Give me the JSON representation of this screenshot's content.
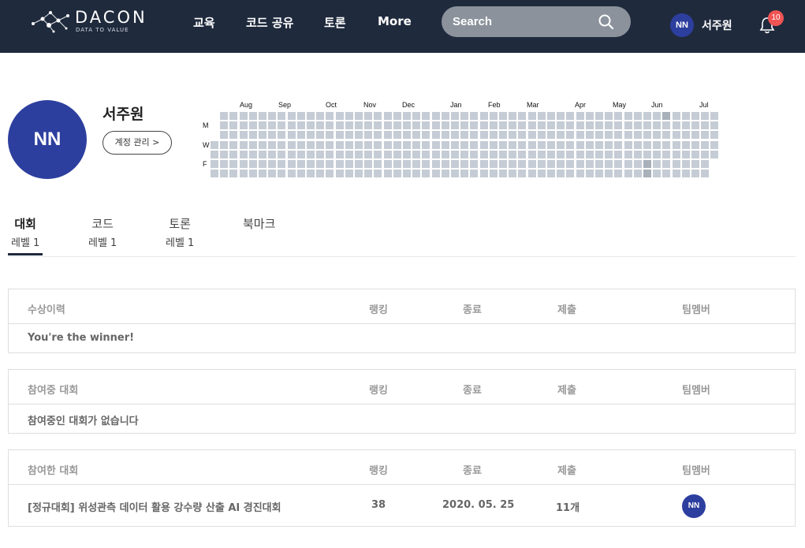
{
  "header": {
    "logo_text": "DACON",
    "logo_tagline": "DATA TO VALUE",
    "nav": [
      "교육",
      "코드 공유",
      "토론",
      "More"
    ],
    "search_placeholder": "Search",
    "user_initials": "NN",
    "user_name": "서주원",
    "notification_count": "10"
  },
  "profile": {
    "initials": "NN",
    "name": "서주원",
    "account_button": "계정 관리 >"
  },
  "activity": {
    "months": [
      "Aug",
      "Sep",
      "Oct",
      "Nov",
      "Dec",
      "Jan",
      "Feb",
      "Mar",
      "Apr",
      "May",
      "Jun",
      "Jul"
    ],
    "day_labels": [
      "M",
      "W",
      "F"
    ]
  },
  "tabs": [
    {
      "title": "대회",
      "level": "레벨 1"
    },
    {
      "title": "코드",
      "level": "레벨 1"
    },
    {
      "title": "토론",
      "level": "레벨 1"
    },
    {
      "title": "북마크",
      "level": ""
    }
  ],
  "sections": {
    "awards": {
      "headers": [
        "수상이력",
        "랭킹",
        "종료",
        "제출",
        "팀멤버"
      ],
      "message": "You're the winner!"
    },
    "ongoing": {
      "headers": [
        "참여중 대회",
        "랭킹",
        "종료",
        "제출",
        "팀멤버"
      ],
      "message": "참여중인 대회가 없습니다"
    },
    "participated": {
      "headers": [
        "참여한 대회",
        "랭킹",
        "종료",
        "제출",
        "팀멤버"
      ],
      "rows": [
        {
          "name": "[정규대회] 위성관측 데이터 활용 강수량 산출 AI 경진대회",
          "rank": "38",
          "end": "2020. 05. 25",
          "submissions": "11개",
          "member": "NN"
        }
      ]
    }
  },
  "colors": {
    "header_bg": "#1f2a3d",
    "avatar": "#2d3f9e",
    "badge": "#f05454",
    "heatmap_cell": "#c5ccd5"
  }
}
